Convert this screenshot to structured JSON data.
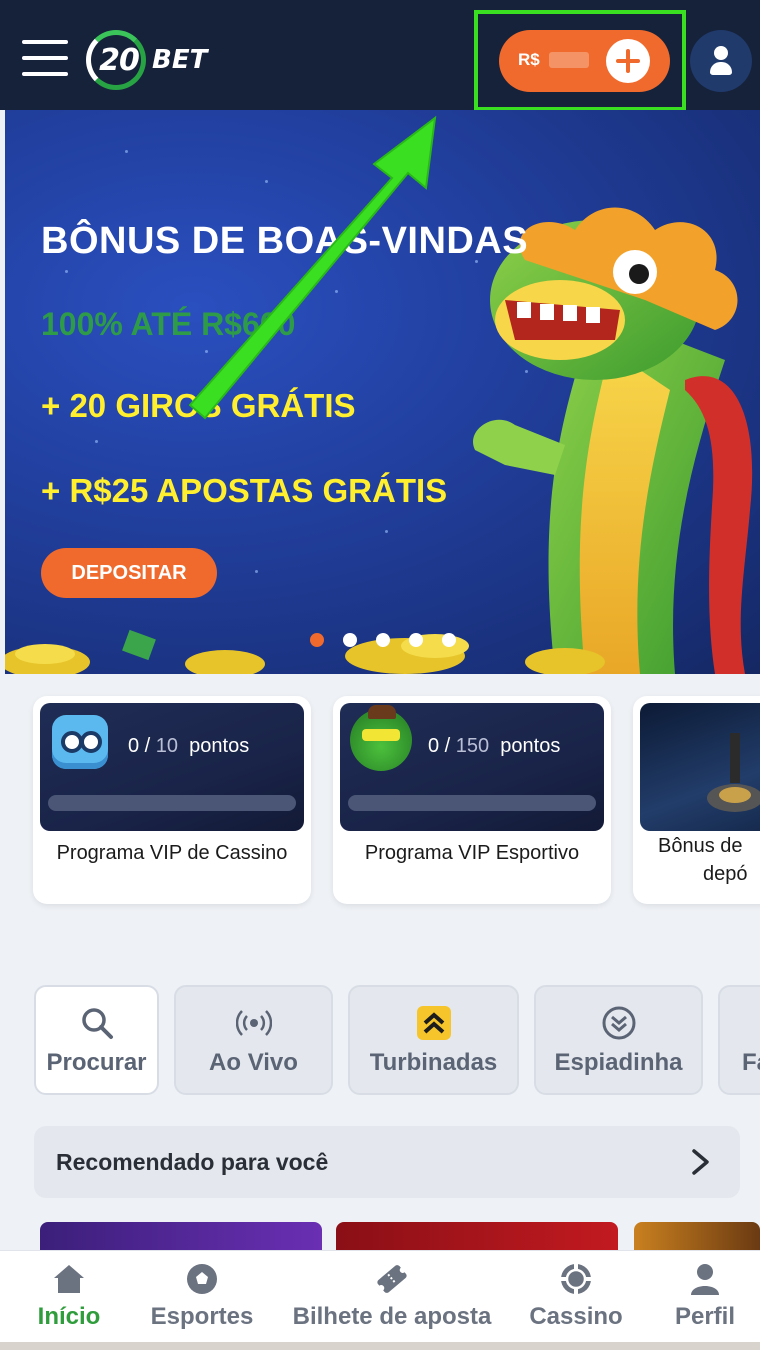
{
  "header": {
    "logo_number": "20",
    "logo_word": "BET",
    "balance_currency": "R$"
  },
  "banner": {
    "title": "BÔNUS DE BOAS-VINDAS",
    "subtitle": "100% ATÉ R$600",
    "line1": "+ 20 GIROS GRÁTIS",
    "line2": "+ R$25 APOSTAS GRÁTIS",
    "cta_label": "DEPOSITAR",
    "slide_count": 5,
    "active_slide": 1
  },
  "promos": [
    {
      "points_current": "0",
      "points_max": "10",
      "points_unit": "pontos",
      "label": "Programa VIP de Cassino",
      "icon": "robot-mascot-icon"
    },
    {
      "points_current": "0",
      "points_max": "150",
      "points_unit": "pontos",
      "label": "Programa VIP Esportivo",
      "icon": "frog-mascot-icon"
    },
    {
      "label_line1": "Bônus de",
      "label_line2": "depó"
    }
  ],
  "categories": [
    {
      "label": "Procurar",
      "icon": "search-icon"
    },
    {
      "label": "Ao Vivo",
      "icon": "live-broadcast-icon"
    },
    {
      "label": "Turbinadas",
      "icon": "boost-chevrons-icon"
    },
    {
      "label": "Espiadinha",
      "icon": "peek-chevron-icon"
    },
    {
      "label": "Fa",
      "icon": "favorites-icon"
    }
  ],
  "recommended": {
    "title": "Recomendado para você"
  },
  "bottom_nav": [
    {
      "label": "Início",
      "icon": "home-icon",
      "active": true
    },
    {
      "label": "Esportes",
      "icon": "soccer-ball-icon",
      "active": false
    },
    {
      "label": "Bilhete de aposta",
      "icon": "ticket-icon",
      "active": false
    },
    {
      "label": "Cassino",
      "icon": "casino-chip-icon",
      "active": false
    },
    {
      "label": "Perfil",
      "icon": "user-icon",
      "active": false
    }
  ],
  "colors": {
    "header_bg": "#16223a",
    "accent_orange": "#ef6a2c",
    "annotation_green": "#3adf21",
    "active_nav_green": "#2f9d3c",
    "banner_yellow": "#ffef2e"
  }
}
